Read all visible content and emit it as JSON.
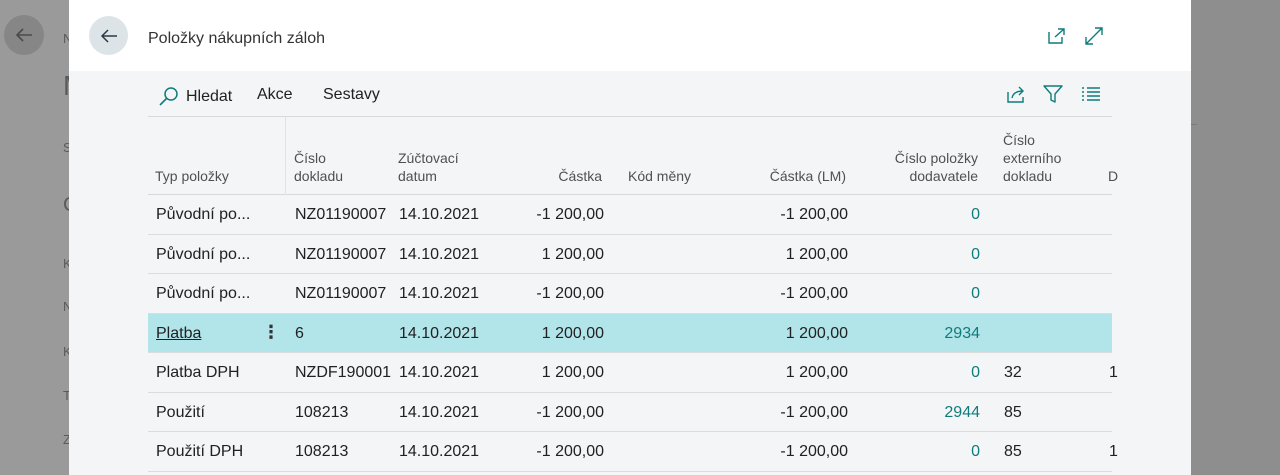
{
  "modal": {
    "title": "Položky nákupních záloh"
  },
  "toolbar": {
    "search_label": "Hledat",
    "actions_label": "Akce",
    "reports_label": "Sestavy"
  },
  "grid": {
    "headers": {
      "typ": [
        "Typ položky"
      ],
      "cislo": [
        "Číslo",
        "dokladu"
      ],
      "datum": [
        "Zúčtovací",
        "datum"
      ],
      "castka": [
        "Částka"
      ],
      "mena": [
        "Kód měny"
      ],
      "castka_lm": [
        "Částka (LM)"
      ],
      "polozka": [
        "Číslo položky",
        "dodavatele"
      ],
      "externi": [
        "Číslo",
        "externího",
        "dokladu"
      ],
      "next": "D"
    },
    "rows": [
      {
        "typ": "Původní po...",
        "cislo": "NZ01190007",
        "datum": "14.10.2021",
        "castka": "-1 200,00",
        "mena": "",
        "castka_lm": "-1 200,00",
        "polozka": "0",
        "externi": "",
        "next": ""
      },
      {
        "typ": "Původní po...",
        "cislo": "NZ01190007",
        "datum": "14.10.2021",
        "castka": "1 200,00",
        "mena": "",
        "castka_lm": "1 200,00",
        "polozka": "0",
        "externi": "",
        "next": ""
      },
      {
        "typ": "Původní po...",
        "cislo": "NZ01190007",
        "datum": "14.10.2021",
        "castka": "-1 200,00",
        "mena": "",
        "castka_lm": "-1 200,00",
        "polozka": "0",
        "externi": "",
        "next": ""
      },
      {
        "typ": "Platba",
        "cislo": "6",
        "datum": "14.10.2021",
        "castka": "1 200,00",
        "mena": "",
        "castka_lm": "1 200,00",
        "polozka": "2934",
        "externi": "",
        "next": ""
      },
      {
        "typ": "Platba DPH",
        "cislo": "NZDF190001",
        "datum": "14.10.2021",
        "castka": "1 200,00",
        "mena": "",
        "castka_lm": "1 200,00",
        "polozka": "0",
        "externi": "32",
        "next": "1"
      },
      {
        "typ": "Použití",
        "cislo": "108213",
        "datum": "14.10.2021",
        "castka": "-1 200,00",
        "mena": "",
        "castka_lm": "-1 200,00",
        "polozka": "2944",
        "externi": "85",
        "next": ""
      },
      {
        "typ": "Použití DPH",
        "cislo": "108213",
        "datum": "14.10.2021",
        "castka": "-1 200,00",
        "mena": "",
        "castka_lm": "-1 200,00",
        "polozka": "0",
        "externi": "85",
        "next": "1"
      }
    ]
  },
  "background": {
    "letters": [
      "N",
      "M",
      "S",
      "C",
      "K",
      "N",
      "K",
      "T",
      "Z"
    ]
  },
  "colors": {
    "accent": "#0f7b7b",
    "selected_row": "#b2e5ea",
    "modal_bg": "#f4f5f6"
  }
}
